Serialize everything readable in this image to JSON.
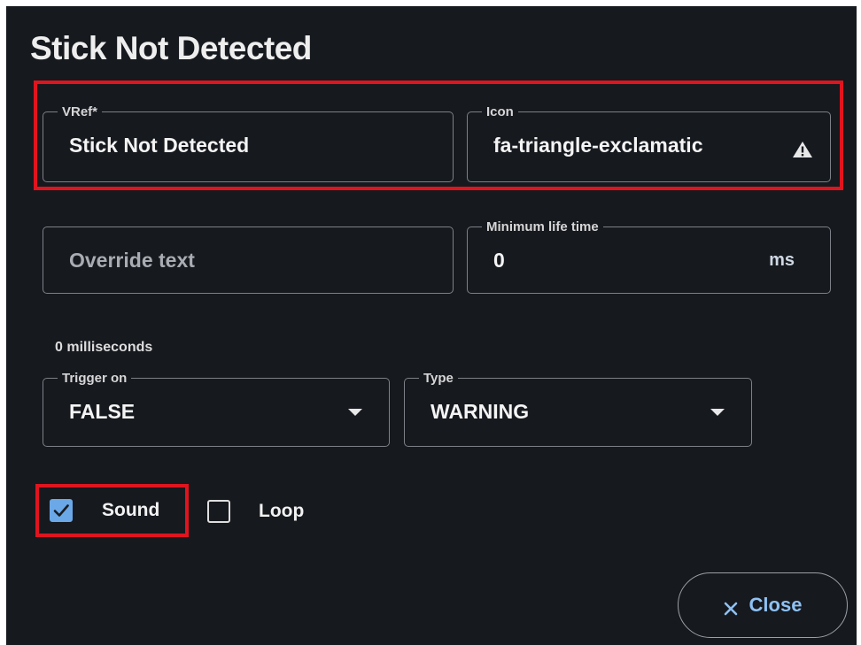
{
  "dialog": {
    "title": "Stick Not Detected"
  },
  "fields": {
    "vref": {
      "label": "VRef*",
      "value": "Stick Not Detected"
    },
    "icon": {
      "label": "Icon",
      "value": "fa-triangle-exclamatic",
      "icon_name": "triangle-exclamation-icon"
    },
    "override_text": {
      "placeholder": "Override text"
    },
    "minimum_life_time": {
      "label": "Minimum life time",
      "value": "0",
      "unit": "ms",
      "hint": "0 milliseconds"
    },
    "trigger_on": {
      "label": "Trigger on",
      "value": "FALSE"
    },
    "type": {
      "label": "Type",
      "value": "WARNING"
    }
  },
  "options": {
    "sound": {
      "label": "Sound",
      "checked": true
    },
    "loop": {
      "label": "Loop",
      "checked": false
    }
  },
  "actions": {
    "close_label": "Close"
  },
  "colors": {
    "background": "#16191e",
    "accent": "#6aa8e8",
    "close_text": "#8ec1f3",
    "highlight": "#e0141e"
  }
}
